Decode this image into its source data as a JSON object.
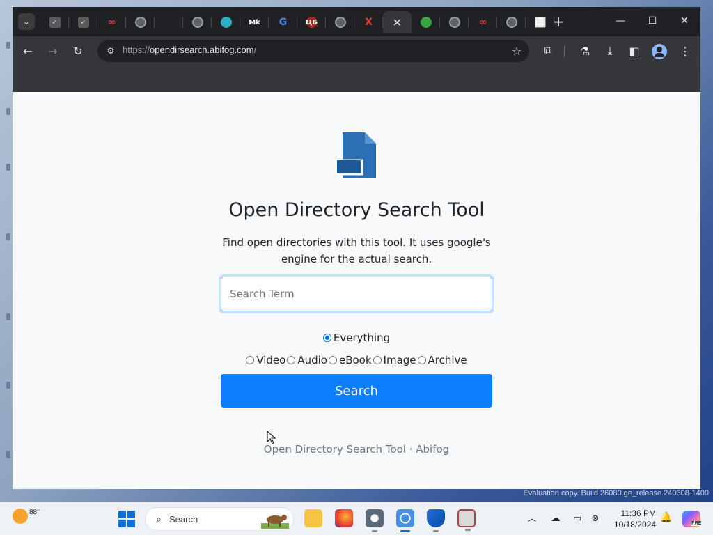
{
  "browser": {
    "tabs": [
      {
        "icon": "checkbox-icon"
      },
      {
        "icon": "checkbox-icon"
      },
      {
        "icon": "infinity-icon"
      },
      {
        "icon": "globe-icon"
      },
      {
        "icon": "blank-icon"
      },
      {
        "icon": "globe-icon"
      },
      {
        "icon": "teal-circle-icon"
      },
      {
        "icon": "mk-icon",
        "text": "Mk"
      },
      {
        "icon": "google-icon",
        "text": "G"
      },
      {
        "icon": "ublock-icon",
        "text": "ЦБ"
      },
      {
        "icon": "globe-icon"
      },
      {
        "icon": "x-icon",
        "text": "X"
      },
      {
        "icon": "close-icon",
        "text": "✕",
        "active": true
      },
      {
        "icon": "green-arrow-icon"
      },
      {
        "icon": "globe-icon"
      },
      {
        "icon": "infinity-icon"
      },
      {
        "icon": "globe-icon"
      },
      {
        "icon": "square-icon"
      }
    ],
    "address_bar": {
      "protocol": "https://",
      "host": "opendirsearch.abifog.com",
      "path": "/"
    }
  },
  "page": {
    "title": "Open Directory Search Tool",
    "description": "Find open directories with this tool. It uses google's engine for the actual search.",
    "search_placeholder": "Search Term",
    "radio_options_row1": [
      {
        "label": "Everything",
        "checked": true
      }
    ],
    "radio_options_row2": [
      {
        "label": "Video",
        "checked": false
      },
      {
        "label": "Audio",
        "checked": false
      },
      {
        "label": "eBook",
        "checked": false
      },
      {
        "label": "Image",
        "checked": false
      },
      {
        "label": "Archive",
        "checked": false
      }
    ],
    "search_button_label": "Search",
    "footer": "Open Directory Search Tool · Abifog",
    "logo_color": "#2c6fb5",
    "button_color": "#0d7efd"
  },
  "watermark": "Evaluation copy. Build 26080.ge_release.240308-1400",
  "taskbar": {
    "weather_temp": "88°",
    "search_label": "Search",
    "clock_time": "11:36 PM",
    "clock_date": "10/18/2024",
    "copilot_badge": "PRE"
  }
}
